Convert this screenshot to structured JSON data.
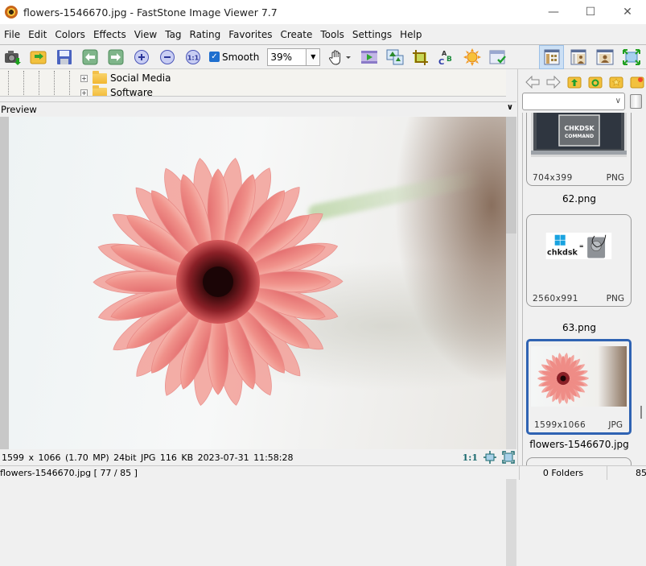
{
  "window": {
    "title": "flowers-1546670.jpg  -  FastStone Image Viewer 7.7",
    "controls": [
      "minimize",
      "maximize",
      "close"
    ]
  },
  "menu": [
    "File",
    "Edit",
    "Colors",
    "Effects",
    "View",
    "Tag",
    "Rating",
    "Favorites",
    "Create",
    "Tools",
    "Settings",
    "Help"
  ],
  "toolbar": {
    "buttons": [
      "camera-capture-icon",
      "open-folder-icon",
      "save-icon",
      "previous-icon",
      "next-icon",
      "zoom-in-icon",
      "zoom-out-icon",
      "actual-size-icon"
    ],
    "smooth_label": "Smooth",
    "smooth_checked": true,
    "zoom_value": "39%",
    "tools": [
      "hand-tool-icon",
      "slideshow-icon",
      "resize-icon",
      "crop-icon",
      "rename-icon",
      "adjust-lighting-icon",
      "batch-icon"
    ],
    "view_modes": [
      "browser-view-icon",
      "thumbnail-view-icon",
      "preview-view-icon",
      "fullscreen-icon"
    ]
  },
  "folder_tree": {
    "items": [
      {
        "label": "Social Media"
      },
      {
        "label": "Software"
      }
    ]
  },
  "preview": {
    "title": "Preview"
  },
  "image_info": {
    "text": "1599 x 1066 (1.70 MP)  24bit  JPG   116 KB   2023-07-31 11:58:28",
    "actual_size_label": "1:1"
  },
  "browser": {
    "path_value": "",
    "thumbnails": [
      {
        "name": "62.png",
        "dims": "704x399",
        "type": "PNG",
        "art": "CHKDSK\nCOMMAND"
      },
      {
        "name": "63.png",
        "dims": "2560x991",
        "type": "PNG",
        "art": "chkdsk"
      },
      {
        "name": "flowers-1546670.jpg",
        "dims": "1599x1066",
        "type": "JPG",
        "selected": true
      }
    ]
  },
  "statusbar": {
    "file": "flowers-1546670.jpg [ 77 / 85 ]",
    "folders": "0 Folders",
    "count": "85"
  },
  "colors": {
    "accent": "#2f63b3",
    "toolbar_bg": "#f0f0f0",
    "checkbox": "#1f6fcf"
  }
}
